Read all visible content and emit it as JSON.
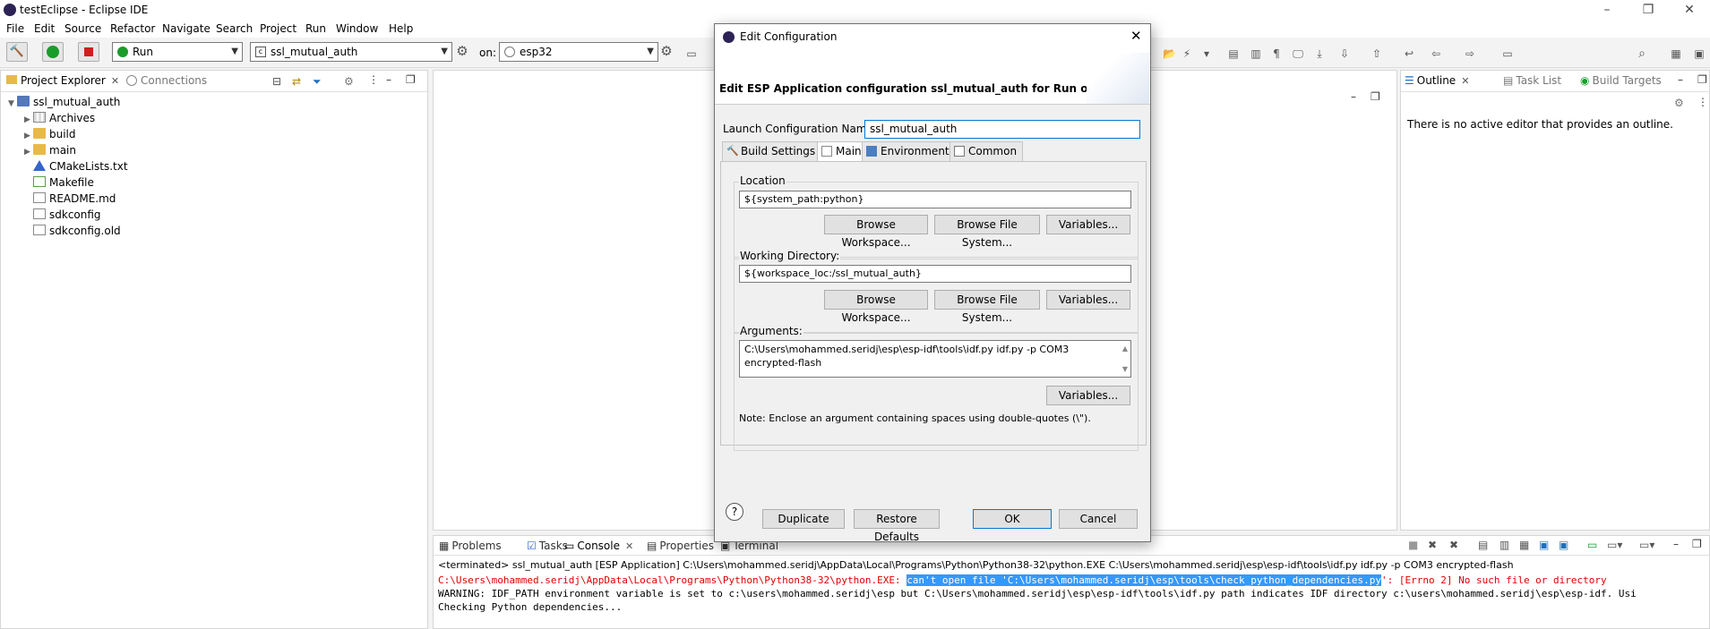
{
  "window": {
    "title": "testEclipse - Eclipse IDE"
  },
  "menubar": {
    "items": [
      "File",
      "Edit",
      "Source",
      "Refactor",
      "Navigate",
      "Search",
      "Project",
      "Run",
      "Window",
      "Help"
    ]
  },
  "toolbar": {
    "mode_combo": "Run",
    "config_combo": "ssl_mutual_auth",
    "on_label": "on:",
    "target_combo": "esp32"
  },
  "left_panel": {
    "tabs": [
      "Project Explorer",
      "Connections"
    ],
    "tree": {
      "root": "ssl_mutual_auth",
      "children": [
        "Archives",
        "build",
        "main",
        "CMakeLists.txt",
        "Makefile",
        "README.md",
        "sdkconfig",
        "sdkconfig.old"
      ]
    }
  },
  "right_panel": {
    "tabs": [
      "Outline",
      "Task List",
      "Build Targets"
    ],
    "message": "There is no active editor that provides an outline."
  },
  "bottom_panel": {
    "tabs": [
      "Problems",
      "Tasks",
      "Console",
      "Properties",
      "Terminal"
    ],
    "terminated_line": "<terminated> ssl_mutual_auth [ESP Application] C:\\Users\\mohammed.seridj\\AppData\\Local\\Programs\\Python\\Python38-32\\python.EXE C:\\Users\\mohammed.seridj\\esp\\esp-idf\\tools\\idf.py idf.py -p COM3 encrypted-flash",
    "error_prefix": "C:\\Users\\mohammed.seridj\\AppData\\Local\\Programs\\Python\\Python38-32\\python.EXE: ",
    "error_highlight": "can't open file 'C:\\Users\\mohammed.seridj\\esp\\tools\\check_python_dependencies.py",
    "error_suffix": "': [Errno 2] No such file or directory",
    "warning_line": "WARNING: IDF_PATH environment variable is set to c:\\users\\mohammed.seridj\\esp but C:\\Users\\mohammed.seridj\\esp\\esp-idf\\tools\\idf.py path indicates IDF directory c:\\users\\mohammed.seridj\\esp\\esp-idf. Usi",
    "checking_line": "Checking Python dependencies..."
  },
  "dialog": {
    "title": "Edit Configuration",
    "header": "Edit ESP Application configuration ssl_mutual_auth for Run on esp",
    "name_label": "Launch Configuration Name:",
    "name_value": "ssl_mutual_auth",
    "tabs": [
      "Build Settings",
      "Main",
      "Environment",
      "Common"
    ],
    "location": {
      "label": "Location",
      "value": "${system_path:python}"
    },
    "working_dir": {
      "label": "Working Directory:",
      "value": "${workspace_loc:/ssl_mutual_auth}"
    },
    "arguments": {
      "label": "Arguments:",
      "line1": "C:\\Users\\mohammed.seridj\\esp\\esp-idf\\tools\\idf.py idf.py -p COM3",
      "line2": "encrypted-flash"
    },
    "browse_workspace": "Browse Workspace...",
    "browse_fs": "Browse File System...",
    "variables": "Variables...",
    "note": "Note: Enclose an argument containing spaces using double-quotes (\\\").",
    "buttons": {
      "help": "?",
      "duplicate": "Duplicate",
      "restore": "Restore Defaults",
      "ok": "OK",
      "cancel": "Cancel"
    }
  },
  "colors": {
    "error_red": "#e00000",
    "selection_blue": "#3399ff",
    "eclipse_purple": "#2c2255",
    "run_green": "#1a9c2a",
    "stop_red": "#d41c1c"
  }
}
